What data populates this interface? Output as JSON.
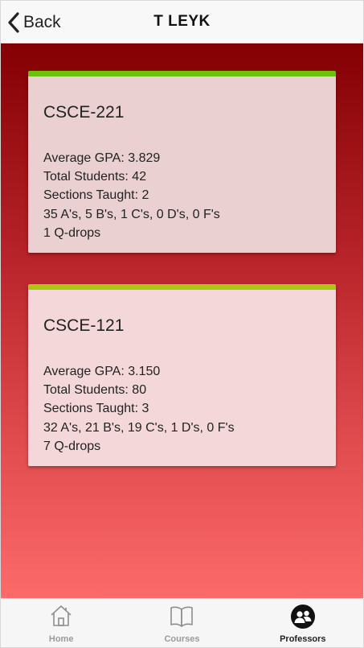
{
  "header": {
    "back_label": "Back",
    "title": "T LEYK"
  },
  "courses": [
    {
      "code": "CSCE-221",
      "average_gpa": "Average GPA: 3.829",
      "total_students": "Total Students: 42",
      "sections_taught": "Sections Taught: 2",
      "grade_distribution": "35 A's, 5 B's, 1 C's, 0 D's, 0 F's",
      "q_drops": "1 Q-drops",
      "accent_color": "#6ac20c"
    },
    {
      "code": "CSCE-121",
      "average_gpa": "Average GPA: 3.150",
      "total_students": "Total Students: 80",
      "sections_taught": "Sections Taught: 3",
      "grade_distribution": "32 A's, 21 B's, 19 C's, 1 D's, 0 F's",
      "q_drops": "7 Q-drops",
      "accent_color": "#a9c80f"
    }
  ],
  "tabbar": {
    "items": [
      {
        "label": "Home",
        "icon": "home-icon",
        "active": false
      },
      {
        "label": "Courses",
        "icon": "book-icon",
        "active": false
      },
      {
        "label": "Professors",
        "icon": "professors-icon",
        "active": true
      }
    ]
  },
  "colors": {
    "background_top": "#840003",
    "background_bottom": "#fd6a6a",
    "active_tab": "#222222",
    "inactive_tab": "#9a9a9a"
  }
}
